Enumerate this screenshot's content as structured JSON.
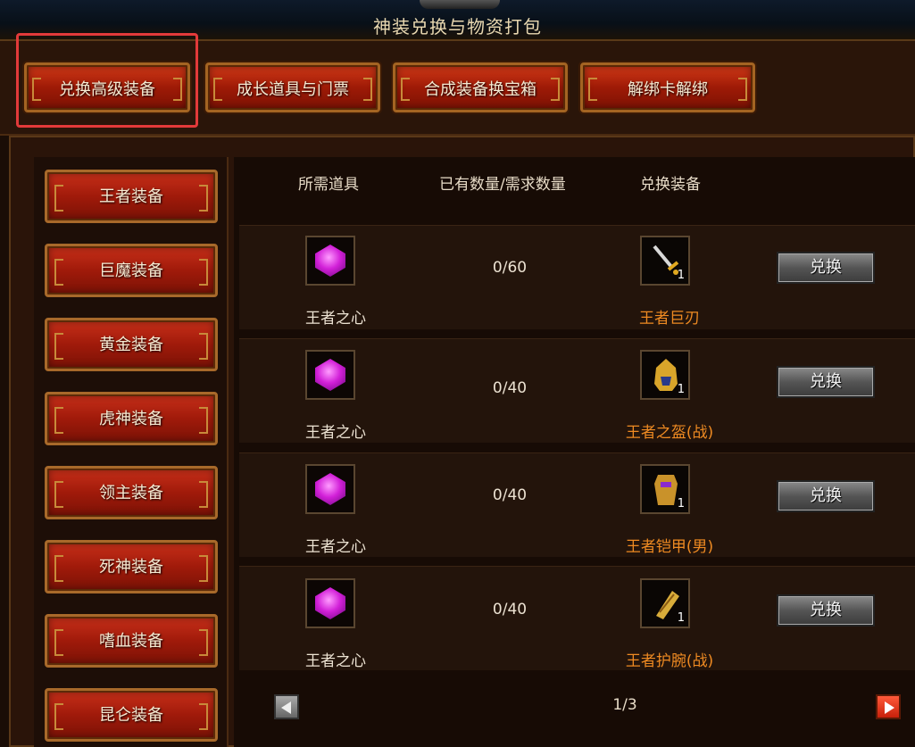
{
  "window": {
    "title": "神装兑换与物资打包"
  },
  "tabs": [
    {
      "label": "兑换高级装备"
    },
    {
      "label": "成长道具与门票"
    },
    {
      "label": "合成装备换宝箱"
    },
    {
      "label": "解绑卡解绑"
    }
  ],
  "sidebar": {
    "items": [
      {
        "label": "王者装备"
      },
      {
        "label": "巨魔装备"
      },
      {
        "label": "黄金装备"
      },
      {
        "label": "虎神装备"
      },
      {
        "label": "领主装备"
      },
      {
        "label": "死神装备"
      },
      {
        "label": "嗜血装备"
      },
      {
        "label": "昆仑装备"
      }
    ]
  },
  "table": {
    "headers": {
      "required": "所需道具",
      "quantity": "已有数量/需求数量",
      "reward": "兑换装备"
    },
    "rows": [
      {
        "item": "王者之心",
        "item_icon": "purple-gem-icon",
        "quantity": "0/60",
        "equip": "王者巨刃",
        "equip_icon": "sword-icon",
        "count": "1",
        "button": "兑换"
      },
      {
        "item": "王者之心",
        "item_icon": "purple-gem-icon",
        "quantity": "0/40",
        "equip": "王者之盔(战)",
        "equip_icon": "helmet-icon",
        "count": "1",
        "button": "兑换"
      },
      {
        "item": "王者之心",
        "item_icon": "purple-gem-icon",
        "quantity": "0/40",
        "equip": "王者铠甲(男)",
        "equip_icon": "armor-icon",
        "count": "1",
        "button": "兑换"
      },
      {
        "item": "王者之心",
        "item_icon": "purple-gem-icon",
        "quantity": "0/40",
        "equip": "王者护腕(战)",
        "equip_icon": "bracer-icon",
        "count": "1",
        "button": "兑换"
      }
    ]
  },
  "pagination": {
    "text": "1/3"
  },
  "colors": {
    "accent": "#ee8a22",
    "tab_red": "#b02410",
    "highlight": "#e23a3a"
  }
}
